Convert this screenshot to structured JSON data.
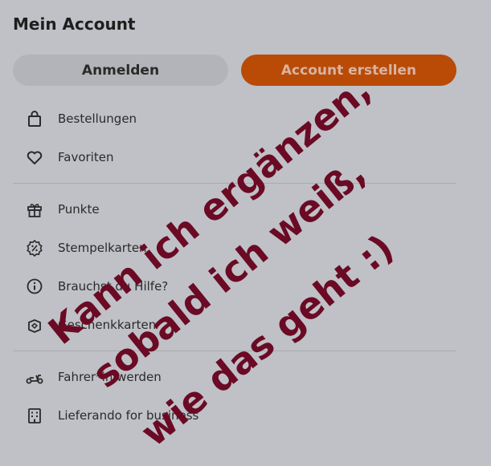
{
  "header": {
    "title": "Mein Account"
  },
  "buttons": {
    "login_label": "Anmelden",
    "create_label": "Account erstellen"
  },
  "menu": {
    "items": [
      {
        "label": "Bestellungen",
        "icon": "shopping-bag-icon"
      },
      {
        "label": "Favoriten",
        "icon": "heart-icon"
      },
      {
        "label": "Punkte",
        "icon": "gift-icon"
      },
      {
        "label": "Stempelkarten",
        "icon": "percent-badge-icon"
      },
      {
        "label": "Brauchst du Hilfe?",
        "icon": "info-icon"
      },
      {
        "label": "Geschenkkarten",
        "icon": "gift-card-icon"
      },
      {
        "label": "Fahrer*in werden",
        "icon": "scooter-icon"
      },
      {
        "label": "Lieferando for business",
        "icon": "building-icon"
      }
    ]
  },
  "watermark": {
    "lines": [
      "Kann ich ergänzen,",
      "sobald ich weiß,",
      "wie das geht :)"
    ],
    "color": "#6b0a24"
  },
  "colors": {
    "background": "#bfc1c7",
    "accent": "#b94b07"
  }
}
